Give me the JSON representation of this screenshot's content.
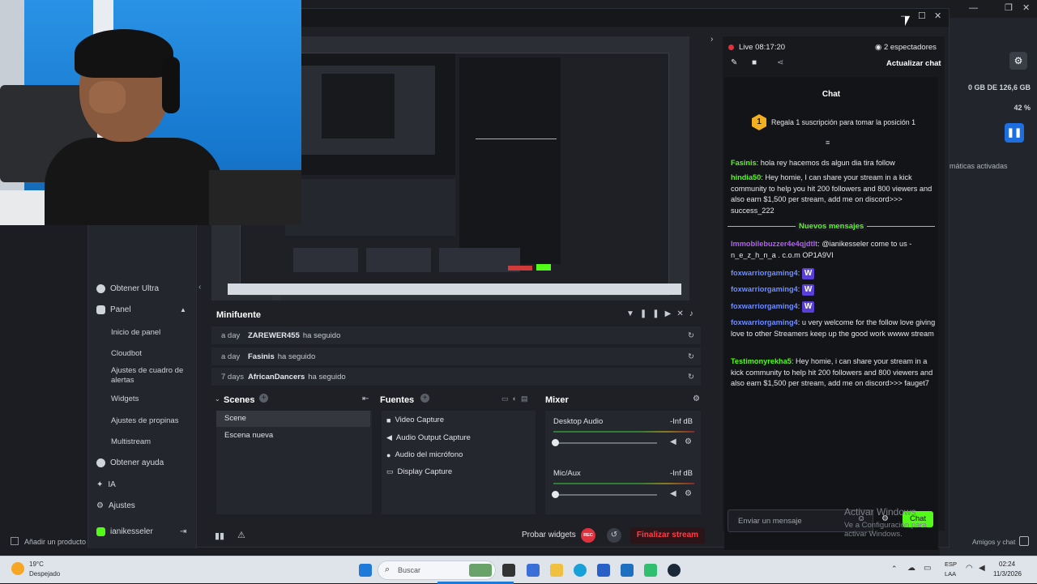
{
  "background_window": {
    "storage": "0 GB DE 126,6 GB",
    "percent": "42 %",
    "automatic": "máticas activadas",
    "add_product": "Añadir un producto",
    "friends_chat": "Amigos y chat"
  },
  "sidebar": {
    "items": [
      {
        "label": "Obtener Ultra",
        "icon": "ultra-icon"
      },
      {
        "label": "Panel",
        "icon": "panel-icon"
      },
      {
        "label": "Inicio de panel"
      },
      {
        "label": "Cloudbot"
      },
      {
        "label": "Ajustes de cuadro de alertas"
      },
      {
        "label": "Widgets"
      },
      {
        "label": "Ajustes de propinas"
      },
      {
        "label": "Multistream"
      },
      {
        "label": "Obtener ayuda",
        "icon": "help-icon"
      },
      {
        "label": "IA",
        "icon": "ai-icon"
      },
      {
        "label": "Ajustes",
        "icon": "settings-icon"
      },
      {
        "label": "ianikesseler",
        "icon": "kick-icon"
      }
    ]
  },
  "minifuente": {
    "title": "Minifuente",
    "rows": [
      {
        "when": "a day",
        "who": "ZAREWER455",
        "action": "ha seguido"
      },
      {
        "when": "a day",
        "who": "Fasinis",
        "action": "ha seguido"
      },
      {
        "when": "7 days",
        "who": "AfricanDancers",
        "action": "ha seguido"
      }
    ]
  },
  "scenes": {
    "title": "Scenes",
    "items": [
      "Scene",
      "Escena nueva"
    ],
    "selected": 0
  },
  "sources": {
    "title": "Fuentes",
    "items": [
      {
        "label": "Video Capture",
        "icon": "camera-icon"
      },
      {
        "label": "Audio Output Capture",
        "icon": "speaker-icon"
      },
      {
        "label": "Audio del micrófono",
        "icon": "microphone-icon"
      },
      {
        "label": "Display Capture",
        "icon": "monitor-icon"
      }
    ]
  },
  "mixer": {
    "title": "Mixer",
    "channels": [
      {
        "label": "Desktop Audio",
        "db": "-Inf dB"
      },
      {
        "label": "Mic/Aux",
        "db": "-Inf dB"
      }
    ]
  },
  "footer": {
    "test_widgets": "Probar widgets",
    "rec": "REC",
    "end_stream": "Finalizar stream"
  },
  "chat": {
    "live": "Live 08:17:20",
    "viewers": "2 espectadores",
    "refresh": "Actualizar chat",
    "title": "Chat",
    "gift_banner": "Regala 1 suscripción para tomar la posición 1",
    "gift_rank": "1",
    "new_messages": "Nuevos mensajes",
    "messages_before": [
      {
        "user": "Fasinis",
        "text": "hola rey hacemos ds algun dia tira follow",
        "color": "#53fc18"
      },
      {
        "user": "hindia50",
        "text": "Hey homie, I can share your stream in a kick community to help you hit 200 followers and 800 viewers and also earn $1,500 per stream, add me on discord>>> success_222",
        "color": "#53fc18"
      }
    ],
    "messages_after": [
      {
        "user": "Immobilebuzzer4e4qjdtlt",
        "text": "@ianikesseler come to us - n_e_z_h_n_a . c.o.m OP1A9VI",
        "color": "#b75cff"
      },
      {
        "user": "foxwarriorgaming4",
        "text": "",
        "emote": true,
        "color": "#6f8cff"
      },
      {
        "user": "foxwarriorgaming4",
        "text": "",
        "emote": true,
        "color": "#6f8cff"
      },
      {
        "user": "foxwarriorgaming4",
        "text": "",
        "emote": true,
        "color": "#6f8cff"
      },
      {
        "user": "foxwarriorgaming4",
        "text": "u very welcome for the follow love giving love to other Streamers keep up the good work wwww stream",
        "color": "#6f8cff"
      },
      {
        "user": "Testimonyrekha5",
        "text": "Hey homie, i can share your stream in a kick community to help hit 200 followers and 800 viewers and also earn $1,500 per stream, add me on discord>>> fauget7",
        "color": "#53fc18"
      }
    ],
    "input_placeholder": "Enviar un mensaje",
    "send_label": "Chat"
  },
  "watermark": {
    "title": "Activar Windows",
    "subtitle": "Ve a Configuración para activar Windows."
  },
  "taskbar": {
    "weather_temp": "19°C",
    "weather_desc": "Despejado",
    "search_placeholder": "Buscar",
    "lang_top": "ESP",
    "lang_bottom": "LAA",
    "time": "02:24",
    "date": "11/3/2026"
  },
  "colors": {
    "accent_green": "#53fc18",
    "end_stream_red": "#e0323e",
    "app_bg": "#1e2026",
    "chat_bg": "#17191d"
  }
}
